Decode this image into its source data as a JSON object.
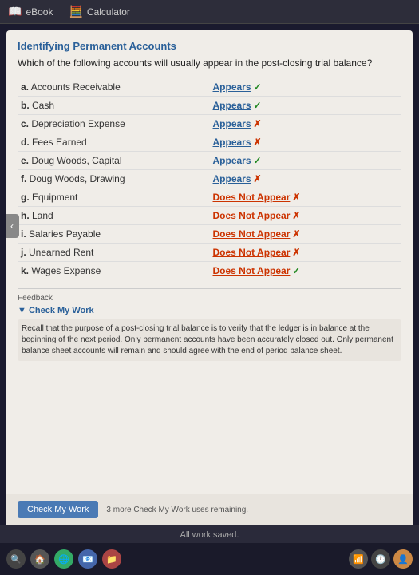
{
  "topbar": {
    "ebook_label": "eBook",
    "calculator_label": "Calculator"
  },
  "page": {
    "section_title": "Identifying Permanent Accounts",
    "question": "Which of the following accounts will usually appear in the post-closing trial balance?",
    "accounts": [
      {
        "letter": "a",
        "name": "Accounts Receivable",
        "answer": "Appears",
        "status": "correct",
        "answer_type": "appears"
      },
      {
        "letter": "b",
        "name": "Cash",
        "answer": "Appears",
        "status": "correct",
        "answer_type": "appears"
      },
      {
        "letter": "c",
        "name": "Depreciation Expense",
        "answer": "Appears",
        "status": "wrong",
        "answer_type": "appears"
      },
      {
        "letter": "d",
        "name": "Fees Earned",
        "answer": "Appears",
        "status": "wrong",
        "answer_type": "appears"
      },
      {
        "letter": "e",
        "name": "Doug Woods, Capital",
        "answer": "Appears",
        "status": "correct",
        "answer_type": "appears"
      },
      {
        "letter": "f",
        "name": "Doug Woods, Drawing",
        "answer": "Appears",
        "status": "wrong",
        "answer_type": "appears"
      },
      {
        "letter": "g",
        "name": "Equipment",
        "answer": "Does Not Appear",
        "status": "wrong",
        "answer_type": "does_not_appear"
      },
      {
        "letter": "h",
        "name": "Land",
        "answer": "Does Not Appear",
        "status": "wrong",
        "answer_type": "does_not_appear"
      },
      {
        "letter": "i",
        "name": "Salaries Payable",
        "answer": "Does Not Appear",
        "status": "wrong",
        "answer_type": "does_not_appear"
      },
      {
        "letter": "j",
        "name": "Unearned Rent",
        "answer": "Does Not Appear",
        "status": "wrong",
        "answer_type": "does_not_appear"
      },
      {
        "letter": "k",
        "name": "Wages Expense",
        "answer": "Does Not Appear",
        "status": "correct",
        "answer_type": "does_not_appear"
      }
    ],
    "feedback": {
      "label": "Feedback",
      "toggle_label": "▼ Check My Work",
      "text": "Recall that the purpose of a post-closing trial balance is to verify that the ledger is in balance at the beginning of the next period. Only permanent accounts have been accurately closed out. Only permanent balance sheet accounts will remain and should agree with the end of period balance sheet."
    },
    "bottom": {
      "button_label": "Check My Work",
      "uses_remaining": "3 more Check My Work uses remaining.",
      "saved_text": "All work saved."
    }
  },
  "nav": {
    "back_arrow": "‹"
  }
}
